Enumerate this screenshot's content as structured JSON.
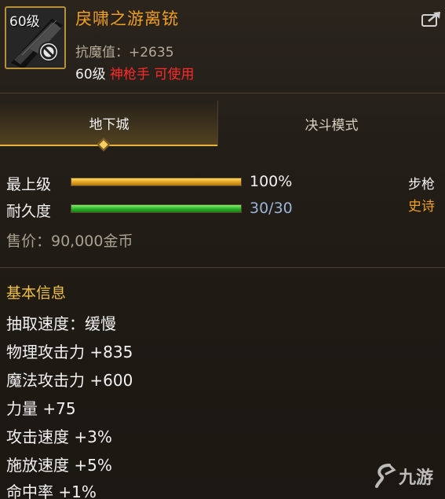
{
  "item": {
    "level_badge": "60级",
    "name": "戾啸之游离铳",
    "anti_magic": "抗魔值：+2635",
    "req_level": "60级",
    "req_class": "神枪手 可使用"
  },
  "tabs": [
    {
      "label": "地下城",
      "active": true
    },
    {
      "label": "决斗模式",
      "active": false
    }
  ],
  "bars": {
    "grade": {
      "label": "最上级",
      "value_text": "100%",
      "fill_fraction": 1.0
    },
    "durability": {
      "label": "耐久度",
      "value_text": "30/30",
      "fill_fraction": 1.0
    }
  },
  "weapon_type": "步枪",
  "rarity": "史诗",
  "price": "售价：90,000金币",
  "basic_info": {
    "title": "基本信息",
    "lines": [
      "抽取速度：缓慢",
      "物理攻击力 +835",
      "魔法攻击力 +600",
      "力量 +75",
      "攻击速度 +3%",
      "施放速度 +5%",
      "命中率 +1%"
    ]
  },
  "watermark": "九游",
  "colors": {
    "name": "#f0a020",
    "class_red": "#ff2a2a",
    "section_gold": "#f0c040",
    "rarity": "#f0a020",
    "grade_bar": "#e0a020",
    "durability_bar": "#2cb028"
  },
  "icons": {
    "item": "rifle-icon",
    "unusable": "ban-icon",
    "share": "share-icon",
    "tab_marker": "diamond-icon",
    "watermark_logo": "nine-game-logo-icon"
  }
}
